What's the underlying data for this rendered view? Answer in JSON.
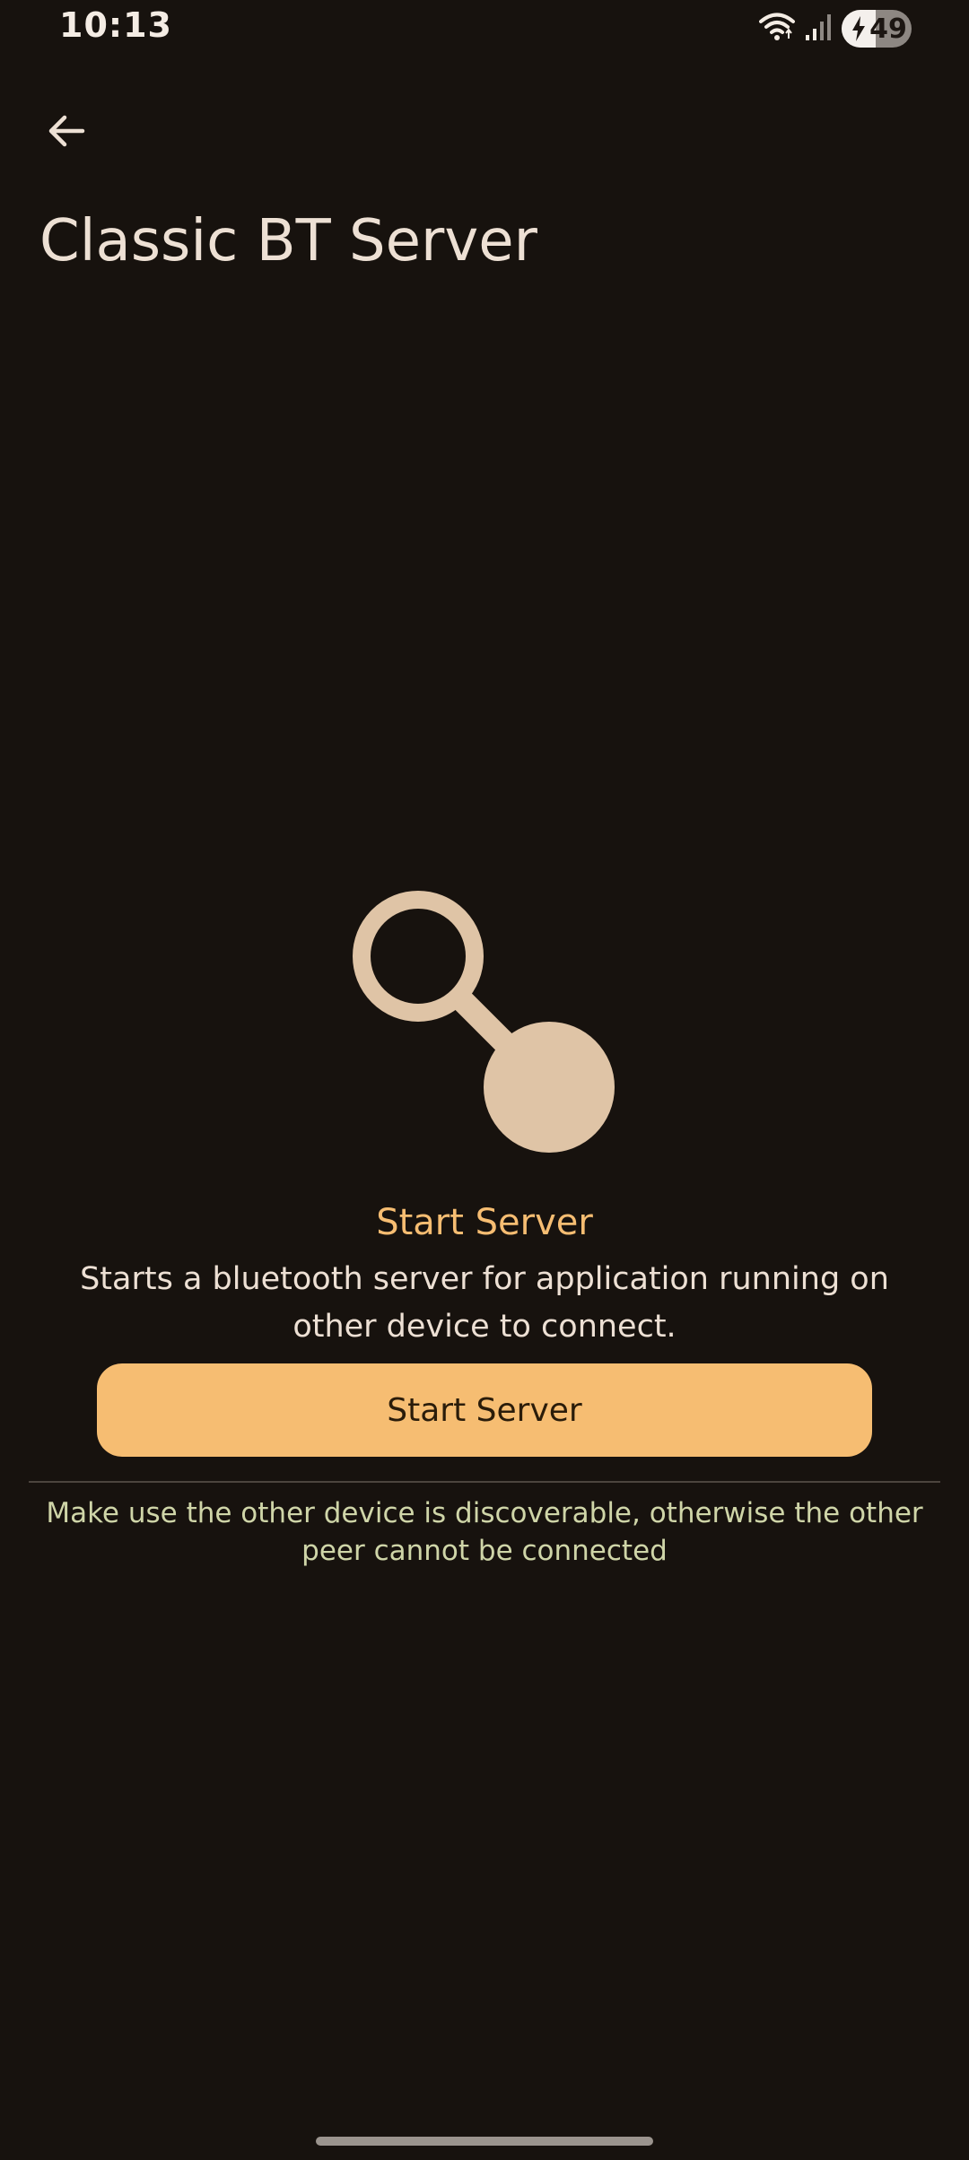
{
  "status_bar": {
    "time": "10:13",
    "battery_level": "49",
    "icons": [
      "wifi-icon",
      "signal-icon",
      "battery-charging-icon"
    ]
  },
  "app_bar": {
    "back_icon": "arrow-left-icon",
    "title": "Classic BT Server"
  },
  "illustration": {
    "icon": "server-link-icon",
    "color": "#dfc4a6"
  },
  "content": {
    "heading": "Start Server",
    "description": "Starts a bluetooth server for application running on other device to connect.",
    "button_label": "Start Server",
    "hint": "Make use the other device is discoverable, otherwise the other peer cannot be connected"
  },
  "colors": {
    "background": "#17120e",
    "accent": "#f6bd72",
    "hint": "#cfd5a8",
    "on_surface": "#ede0d4"
  }
}
